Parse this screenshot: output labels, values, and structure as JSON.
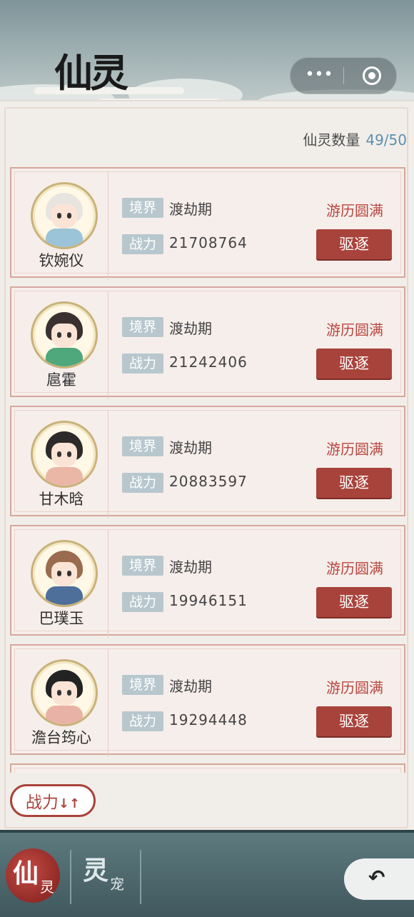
{
  "header": {
    "title": "仙灵",
    "capsule_dots": "•••"
  },
  "panel": {
    "count_label": "仙灵数量",
    "count_value": "49/50"
  },
  "labels": {
    "realm": "境界",
    "power": "战力"
  },
  "characters": [
    {
      "name": "钦婉仪",
      "realm": "渡劫期",
      "power": "21708764",
      "status": "游历圆满",
      "action": "驱逐",
      "hair": "#e8e4e0",
      "outfit": "#9cc4d8"
    },
    {
      "name": "扈霍",
      "realm": "渡劫期",
      "power": "21242406",
      "status": "游历圆满",
      "action": "驱逐",
      "hair": "#3a3030",
      "outfit": "#4fa77c"
    },
    {
      "name": "甘木晗",
      "realm": "渡劫期",
      "power": "20883597",
      "status": "游历圆满",
      "action": "驱逐",
      "hair": "#2e2a2a",
      "outfit": "#eab7a6"
    },
    {
      "name": "巴璞玉",
      "realm": "渡劫期",
      "power": "19946151",
      "status": "游历圆满",
      "action": "驱逐",
      "hair": "#9a6b4e",
      "outfit": "#4e6f9a"
    },
    {
      "name": "澹台筠心",
      "realm": "渡劫期",
      "power": "19294448",
      "status": "游历圆满",
      "action": "驱逐",
      "hair": "#232323",
      "outfit": "#e8b3a6"
    }
  ],
  "sort_button": {
    "label": "战力",
    "arrows": "↓↑"
  },
  "nav": {
    "tab1": {
      "main": "仙",
      "sub": "灵"
    },
    "tab2": {
      "main": "灵",
      "sub": "宠"
    },
    "back_icon": "↶"
  }
}
